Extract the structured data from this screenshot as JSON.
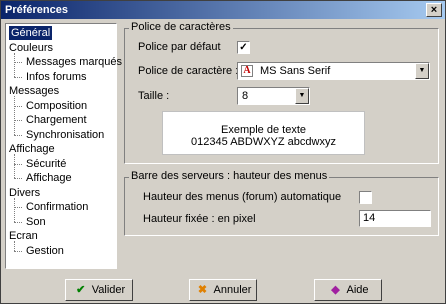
{
  "window": {
    "title": "Préférences",
    "close_label": "×"
  },
  "tree": {
    "items": [
      {
        "label": "Général",
        "level": 0,
        "selected": true
      },
      {
        "label": "Couleurs",
        "level": 0
      },
      {
        "label": "Messages marqués",
        "level": 1
      },
      {
        "label": "Infos forums",
        "level": 1
      },
      {
        "label": "Messages",
        "level": 0
      },
      {
        "label": "Composition",
        "level": 1
      },
      {
        "label": "Chargement",
        "level": 1
      },
      {
        "label": "Synchronisation",
        "level": 1
      },
      {
        "label": "Affichage",
        "level": 0
      },
      {
        "label": "Sécurité",
        "level": 1
      },
      {
        "label": "Affichage",
        "level": 1
      },
      {
        "label": "Divers",
        "level": 0
      },
      {
        "label": "Confirmation",
        "level": 1
      },
      {
        "label": "Son",
        "level": 1
      },
      {
        "label": "Ecran",
        "level": 0
      },
      {
        "label": "Gestion",
        "level": 1
      }
    ]
  },
  "font_group": {
    "title": "Police de caractères",
    "default_font_label": "Police par défaut",
    "default_font_checked": true,
    "font_label": "Police de caractère :",
    "font_value": "MS Sans Serif",
    "size_label": "Taille :",
    "size_value": "8",
    "sample_line1": "Exemple de texte",
    "sample_line2": "012345 ABDWXYZ abcdwxyz"
  },
  "servers_group": {
    "title": "Barre des serveurs : hauteur des menus",
    "auto_height_label": "Hauteur des menus (forum) automatique",
    "auto_height_checked": false,
    "fixed_height_label": "Hauteur fixée : en pixel",
    "fixed_height_value": "14"
  },
  "buttons": {
    "ok_label": "Valider",
    "cancel_label": "Annuler",
    "help_label": "Aide"
  },
  "icons": {
    "check_mark": "✓",
    "dropdown_arrow": "▼",
    "font_glyph": "A",
    "ok_icon": "✔",
    "cancel_icon": "✖",
    "help_icon": "◆"
  }
}
